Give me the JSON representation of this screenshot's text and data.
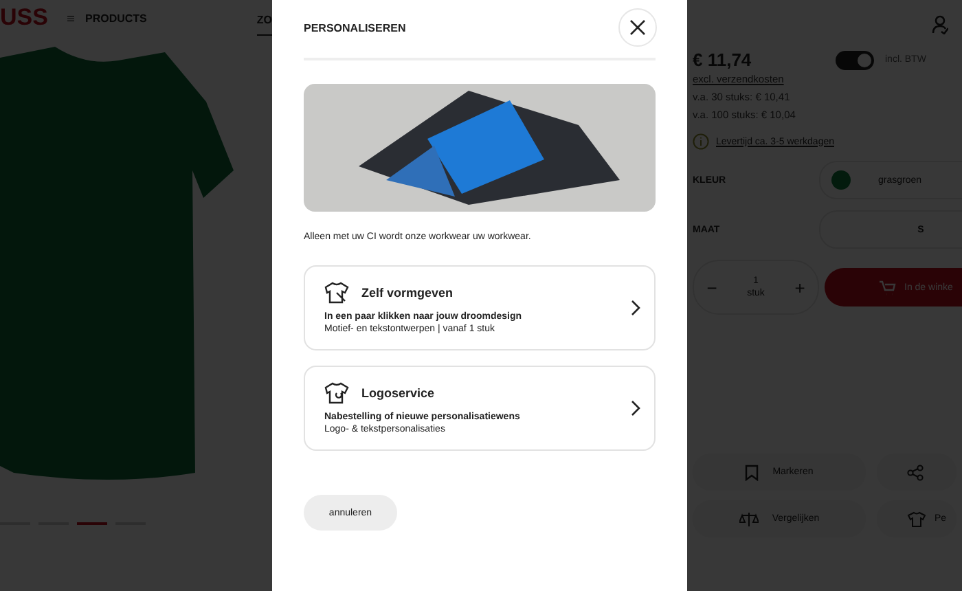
{
  "header": {
    "logo": "USS",
    "menu_label": "PRODUCTS",
    "tabs": [
      {
        "label": "ZO",
        "selected": true
      }
    ]
  },
  "gallery": {
    "dots": [
      {
        "selected": false
      },
      {
        "selected": false
      },
      {
        "selected": true
      },
      {
        "selected": false
      }
    ]
  },
  "product": {
    "price": "€ 11,74",
    "shipping_note": "excl. verzendkosten",
    "tiers": [
      "v.a. 30 stuks: € 10,41",
      "v.a. 100 stuks: € 10,04"
    ],
    "vat_toggle": {
      "label": "incl. BTW",
      "on": true
    },
    "delivery": "Levertijd ca. 3-5 werkdagen",
    "color": {
      "label": "KLEUR",
      "value": "grasgroen"
    },
    "size": {
      "label": "MAAT",
      "value": "S"
    },
    "quantity": {
      "minus": "−",
      "value": "1",
      "unit": "stuk",
      "plus": "+"
    },
    "cart_button": "In de winke",
    "actions": [
      {
        "kind": "bookmark",
        "label": "Markeren"
      },
      {
        "kind": "share"
      },
      {
        "kind": "compare",
        "label": "Vergelijken"
      },
      {
        "kind": "shirt",
        "label": "Pe"
      }
    ]
  },
  "modal": {
    "title": "PERSONALISEREN",
    "intro": "Alleen met uw CI wordt onze workwear uw workwear.",
    "options": [
      {
        "kind": "design",
        "title": "Zelf vormgeven",
        "subtitle": "In een paar klikken naar jouw droomdesign",
        "description": "Motief- en tekstontwerpen | vanaf 1 stuk"
      },
      {
        "kind": "logo",
        "title": "Logoservice",
        "subtitle": "Nabestelling of nieuwe personalisatiewens",
        "description": "Logo- & tekstpersonalisaties"
      }
    ],
    "cancel": "annuleren"
  }
}
